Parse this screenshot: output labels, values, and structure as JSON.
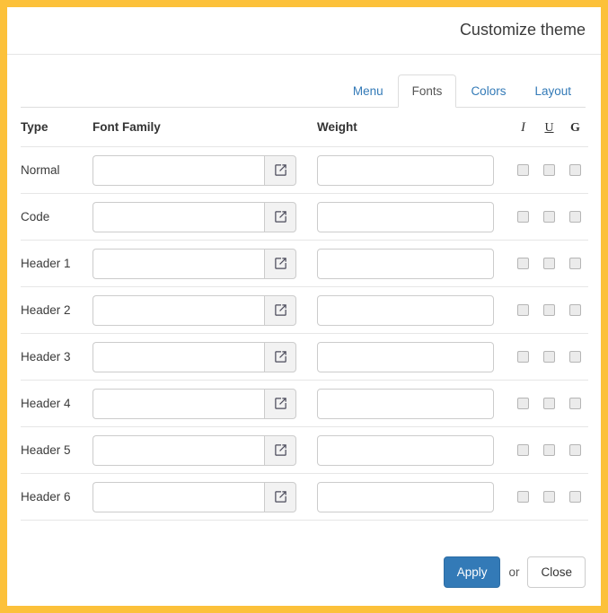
{
  "window": {
    "title": "Customize theme",
    "accent_border_color": "#fcc13a"
  },
  "tabs": [
    {
      "label": "Menu",
      "active": false
    },
    {
      "label": "Fonts",
      "active": true
    },
    {
      "label": "Colors",
      "active": false
    },
    {
      "label": "Layout",
      "active": false
    }
  ],
  "table": {
    "headers": {
      "type": "Type",
      "font_family": "Font Family",
      "weight": "Weight",
      "italic": "I",
      "underline": "U",
      "bold": "G"
    },
    "rows": [
      {
        "type": "Normal",
        "font_family": "",
        "weight": "",
        "italic": false,
        "underline": false,
        "bold": false
      },
      {
        "type": "Code",
        "font_family": "",
        "weight": "",
        "italic": false,
        "underline": false,
        "bold": false
      },
      {
        "type": "Header 1",
        "font_family": "",
        "weight": "",
        "italic": false,
        "underline": false,
        "bold": false
      },
      {
        "type": "Header 2",
        "font_family": "",
        "weight": "",
        "italic": false,
        "underline": false,
        "bold": false
      },
      {
        "type": "Header 3",
        "font_family": "",
        "weight": "",
        "italic": false,
        "underline": false,
        "bold": false
      },
      {
        "type": "Header 4",
        "font_family": "",
        "weight": "",
        "italic": false,
        "underline": false,
        "bold": false
      },
      {
        "type": "Header 5",
        "font_family": "",
        "weight": "",
        "italic": false,
        "underline": false,
        "bold": false
      },
      {
        "type": "Header 6",
        "font_family": "",
        "weight": "",
        "italic": false,
        "underline": false,
        "bold": false
      }
    ],
    "browse_icon": "external-link-icon"
  },
  "footer": {
    "apply_label": "Apply",
    "or_label": "or",
    "close_label": "Close",
    "apply_color": "#337ab7"
  }
}
